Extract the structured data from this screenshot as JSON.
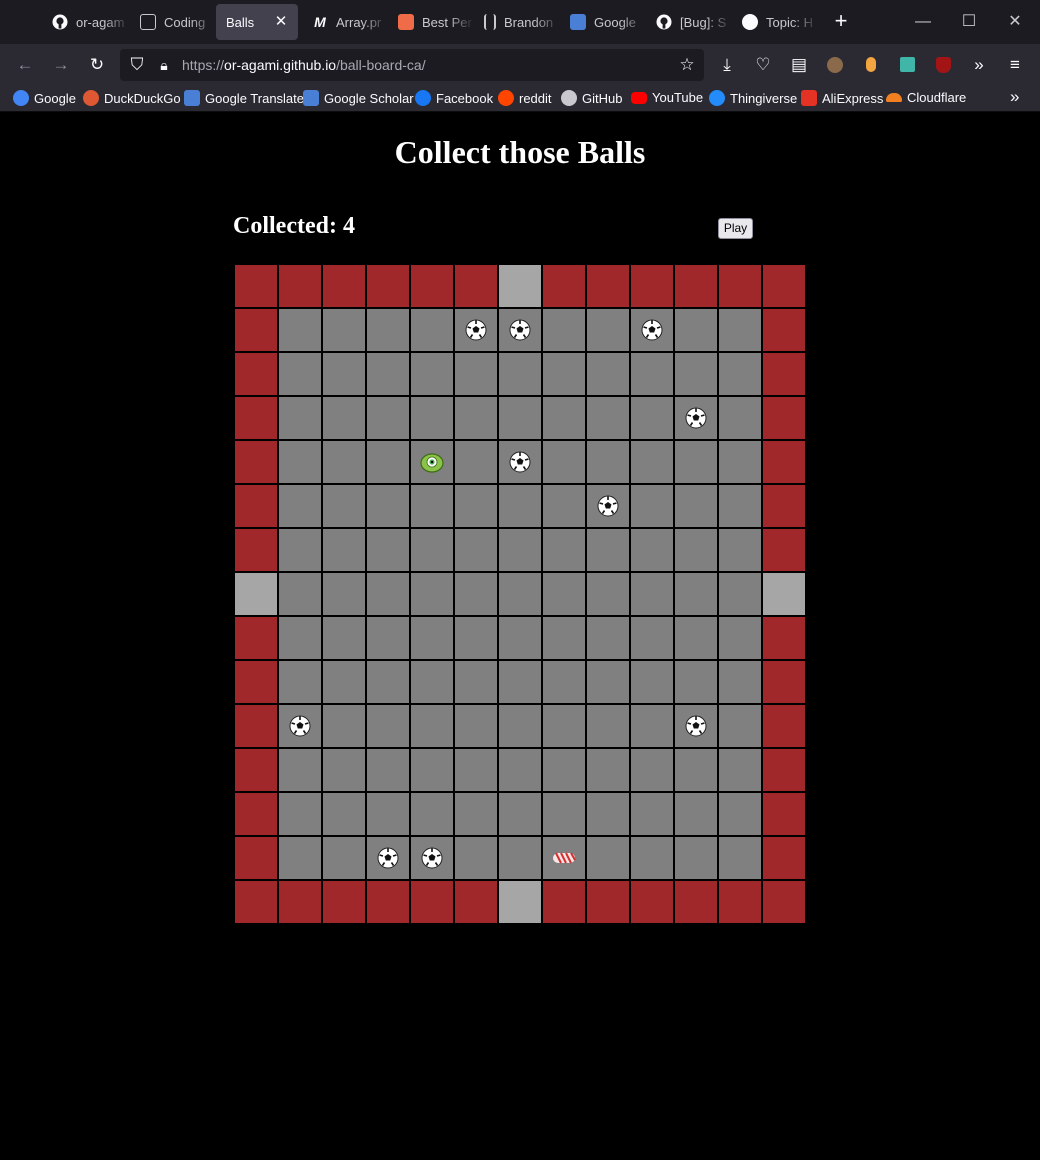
{
  "browser": {
    "tabs": [
      {
        "label": "or-agam",
        "fav": "#fbfbfe",
        "icon": "github-icon"
      },
      {
        "label": "Coding",
        "fav": "#c9c8cf",
        "icon": "terminal-icon"
      },
      {
        "label": "Balls",
        "fav": "",
        "icon": ""
      },
      {
        "label": "Array.pr",
        "fav": "#fbfbfe",
        "icon": "medium-icon"
      },
      {
        "label": "Best Per",
        "fav": "#f06b47",
        "icon": "hackerrank-icon"
      },
      {
        "label": "Brandon",
        "fav": "#c9c8cf",
        "icon": "bars-icon"
      },
      {
        "label": "Google",
        "fav": "#4a7fd6",
        "icon": "google-translate-icon"
      },
      {
        "label": "[Bug]: S",
        "fav": "#fbfbfe",
        "icon": "github-icon"
      },
      {
        "label": "Topic: H",
        "fav": "#fbfbfe",
        "icon": "wordpress-icon"
      }
    ],
    "tab_close": "✕",
    "new_tab": "+",
    "url": {
      "prefix": "https://",
      "domain": "or-agami.github.io",
      "path": "/ball-board-ca/"
    },
    "bookmarks": [
      {
        "label": "Google",
        "color": "#4285f4"
      },
      {
        "label": "DuckDuckGo",
        "color": "#de5833"
      },
      {
        "label": "Google Translate",
        "color": "#4a7fd6"
      },
      {
        "label": "Google Scholar",
        "color": "#4a7fd6"
      },
      {
        "label": "Facebook",
        "color": "#1877f2"
      },
      {
        "label": "reddit",
        "color": "#ff4500"
      },
      {
        "label": "GitHub",
        "color": "#c9c8cf"
      },
      {
        "label": "YouTube",
        "color": "#ff0000"
      },
      {
        "label": "Thingiverse",
        "color": "#248bfb"
      },
      {
        "label": "AliExpress",
        "color": "#e43225"
      },
      {
        "label": "Cloudflare",
        "color": "#f38020"
      }
    ]
  },
  "page": {
    "title": "Collect those Balls",
    "collected_label": "Collected: 4",
    "play_label": "Play"
  },
  "board": {
    "rows": 15,
    "cols": 13,
    "legend": {
      "W": "wall",
      "F": "floor",
      "G": "gap",
      "B": "ball",
      "P": "player",
      "C": "candy"
    },
    "grid": [
      "WWWWWWGWWWWWW",
      "WFFFFBBFFBFFW",
      "WFFFFFFFFFFFW",
      "WFFFFFFFFFBFW",
      "WFFFPFBFFFFFW",
      "WFFFFFFFBFFFW",
      "WFFFFFFFFFFFW",
      "GFFFFFFFFFFFG",
      "WFFFFFFFFFFFW",
      "WFFFFFFFFFFFW",
      "WBFFFFFFFFBFW",
      "WFFFFFFFFFFFW",
      "WFFFFFFFFFFFW",
      "WFFBBFFCFFFFW",
      "WWWWWWGWWWWWW"
    ],
    "colors": {
      "wall": "#a0282b",
      "floor": "#808080",
      "gap": "#a6a6a6"
    }
  }
}
